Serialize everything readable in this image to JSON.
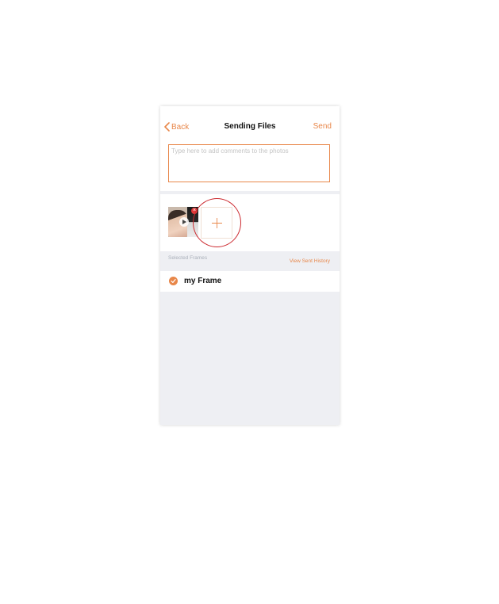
{
  "nav": {
    "back_label": "Back",
    "title": "Sending Files",
    "send_label": "Send"
  },
  "comment": {
    "placeholder": "Type here to add comments to the photos",
    "value": ""
  },
  "photos": {
    "items": [
      {
        "type": "video-thumbnail",
        "remove_icon": "close-badge-icon"
      }
    ],
    "add_icon": "plus-icon"
  },
  "frames": {
    "section_label": "Selected Frames",
    "history_link": "View Sent History",
    "items": [
      {
        "name": "my Frame",
        "selected": true
      }
    ]
  },
  "colors": {
    "accent": "#e8874a",
    "highlight_ring": "#cc2a30",
    "background": "#eeeff3"
  }
}
